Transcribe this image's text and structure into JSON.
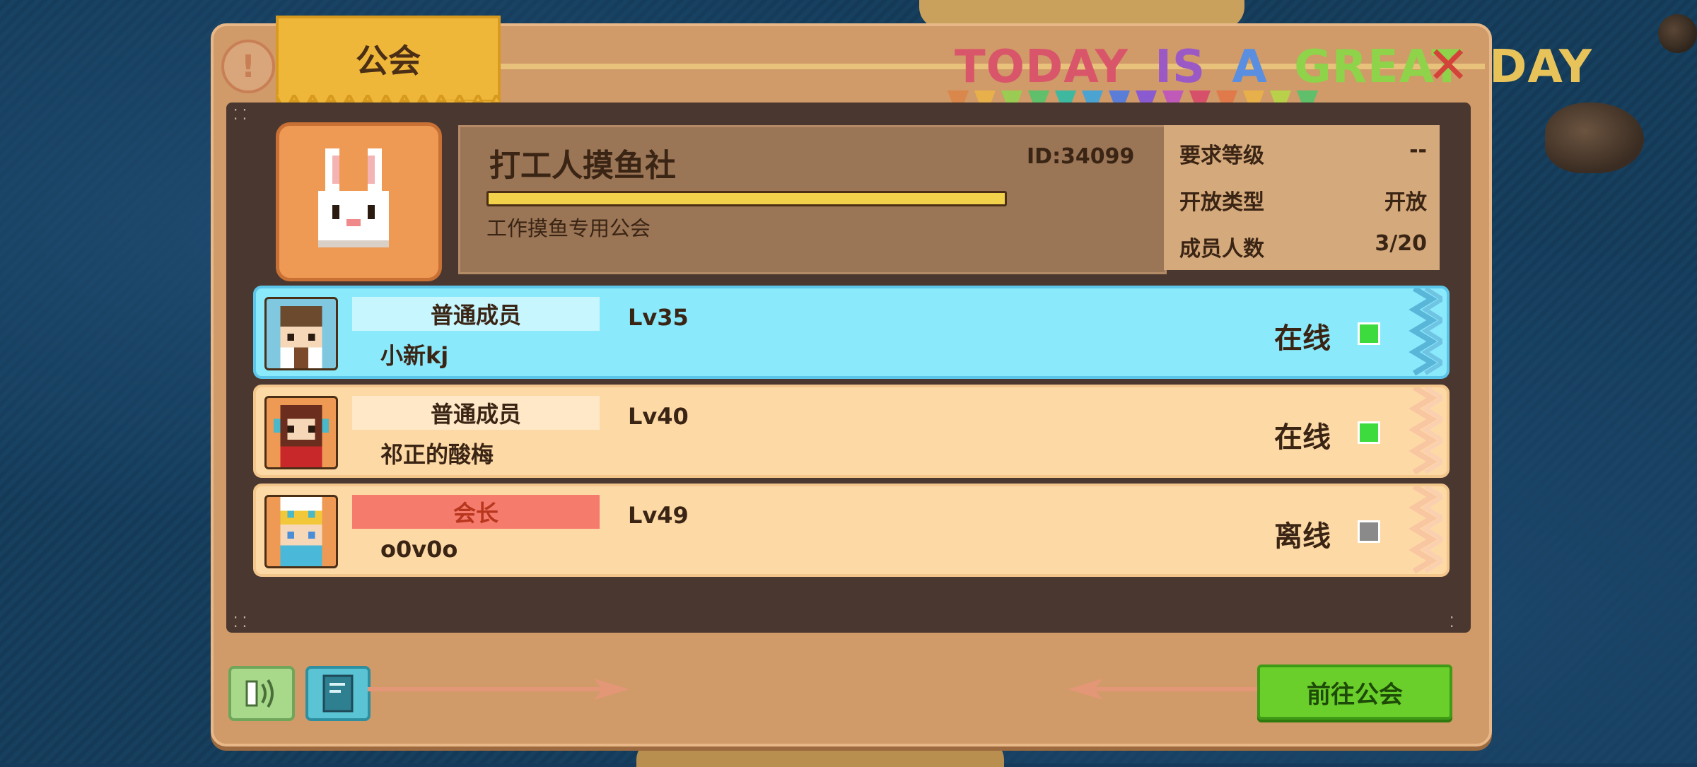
{
  "header": {
    "tab_title": "公会",
    "banner_words": [
      {
        "text": "TODAY",
        "color": "#d9566a"
      },
      {
        "text": "IS",
        "color": "#9b59c6"
      },
      {
        "text": "A",
        "color": "#5a8ee0"
      },
      {
        "text": "GREAT",
        "color": "#8ed34a"
      },
      {
        "text": "DAY",
        "color": "#e8c35a"
      }
    ],
    "close_symbol": "✕",
    "info_symbol": "!"
  },
  "guild": {
    "name": "打工人摸鱼社",
    "id_text": "ID:34099",
    "description": "工作摸鱼专用公会",
    "emblem_icon": "bunny-icon",
    "stats": [
      {
        "label": "要求等级",
        "value": "--"
      },
      {
        "label": "开放类型",
        "value": "开放"
      },
      {
        "label": "成员人数",
        "value": "3/20"
      }
    ]
  },
  "members": [
    {
      "role": "普通成员",
      "name": "小新kj",
      "level": "Lv35",
      "status": "在线",
      "online": true,
      "selected": true,
      "role_color": "#c8f6ff",
      "role_text_color": "#3a2414"
    },
    {
      "role": "普通成员",
      "name": "祁正的酸梅",
      "level": "Lv40",
      "status": "在线",
      "online": true,
      "selected": false,
      "role_color": "#ffe8c8",
      "role_text_color": "#3a2414"
    },
    {
      "role": "会长",
      "name": "o0v0o",
      "level": "Lv49",
      "status": "离线",
      "online": false,
      "selected": false,
      "role_color": "#f57b6c",
      "role_text_color": "#b8361e"
    }
  ],
  "footer": {
    "go_button": "前往公会"
  },
  "colors": {
    "online": "#3ddb3d",
    "offline": "#8a8a8a"
  }
}
